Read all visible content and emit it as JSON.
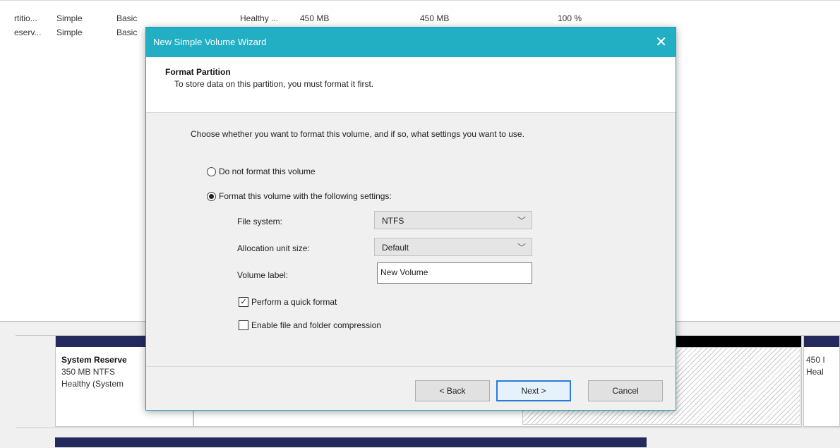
{
  "volume_list": {
    "rows": [
      {
        "layout": "rtitio...",
        "type": "Simple",
        "kind": "Basic",
        "status": "Healthy ...",
        "capacity": "450 MB",
        "free": "450 MB",
        "pct_free": "100 %"
      },
      {
        "layout": "eserv...",
        "type": "Simple",
        "kind": "Basic",
        "status": "",
        "capacity": "",
        "free": "",
        "pct_free": ""
      }
    ]
  },
  "disk_map": {
    "partition_name": "System Reserve",
    "partition_size": "350 MB NTFS",
    "partition_status": "Healthy (System",
    "right_size": "450 I",
    "right_status": "Heal",
    "colors": {
      "primary_bar": "#252a5c",
      "unallocated_bar": "#000000"
    }
  },
  "wizard": {
    "title": "New Simple Volume Wizard",
    "close_glyph": "✕",
    "header_title": "Format Partition",
    "header_subtitle": "To store data on this partition, you must format it first.",
    "instruction": "Choose whether you want to format this volume, and if so, what settings you want to use.",
    "options": {
      "no_format": {
        "label": "Do not format this volume",
        "selected": false
      },
      "format": {
        "label": "Format this volume with the following settings:",
        "selected": true
      }
    },
    "file_system": {
      "label": "File system:",
      "value": "NTFS"
    },
    "allocation_unit": {
      "label": "Allocation unit size:",
      "value": "Default"
    },
    "volume_label": {
      "label": "Volume label:",
      "value": "New Volume"
    },
    "quick_format": {
      "label": "Perform a quick format",
      "checked": true,
      "mark": "✓"
    },
    "compression": {
      "label": "Enable file and folder compression",
      "checked": false
    },
    "buttons": {
      "back": "< Back",
      "next": "Next >",
      "cancel": "Cancel"
    },
    "colors": {
      "titlebar": "#22aec3",
      "default_button_border": "#2a7bd6"
    }
  }
}
